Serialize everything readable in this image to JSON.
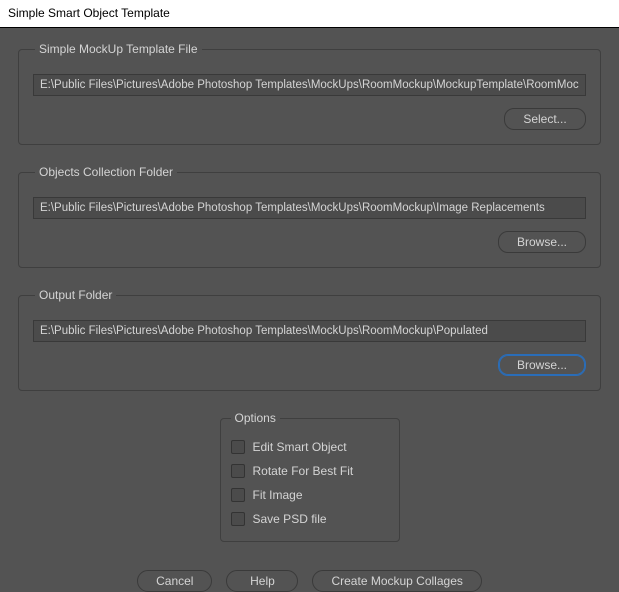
{
  "title": "Simple Smart Object Template",
  "groups": {
    "template": {
      "legend": "Simple MockUp Template File",
      "path": "E:\\Public Files\\Pictures\\Adobe Photoshop Templates\\MockUps\\RoomMockup\\MockupTemplate\\RoomMockup.psd",
      "button": "Select..."
    },
    "collection": {
      "legend": "Objects Collection Folder",
      "path": "E:\\Public Files\\Pictures\\Adobe Photoshop Templates\\MockUps\\RoomMockup\\Image Replacements",
      "button": "Browse..."
    },
    "output": {
      "legend": "Output Folder",
      "path": "E:\\Public Files\\Pictures\\Adobe Photoshop Templates\\MockUps\\RoomMockup\\Populated",
      "button": "Browse..."
    }
  },
  "options": {
    "legend": "Options",
    "items": [
      "Edit Smart Object",
      "Rotate For Best Fit",
      "Fit Image",
      "Save PSD file"
    ]
  },
  "buttons": {
    "cancel": "Cancel",
    "help": "Help",
    "create": "Create Mockup Collages"
  }
}
